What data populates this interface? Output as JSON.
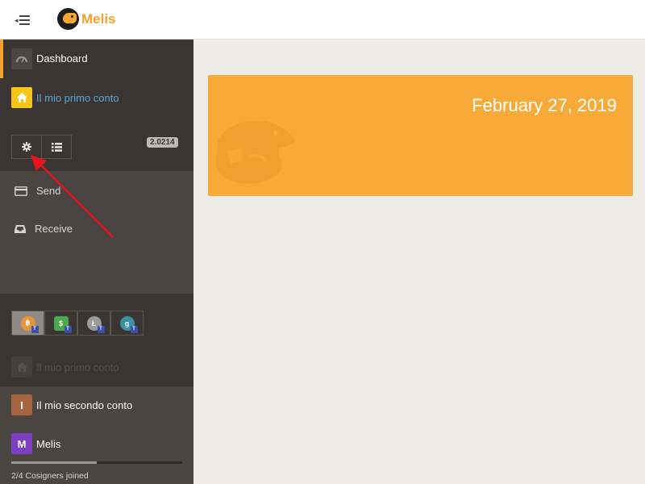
{
  "app": {
    "name": "Melis"
  },
  "sidebar": {
    "dashboard_label": "Dashboard",
    "current_account": "Il mio primo conto",
    "version_badge": "2.0214",
    "actions": [
      {
        "label": "Send",
        "icon": "credit-card-icon"
      },
      {
        "label": "Receive",
        "icon": "inbox-icon"
      }
    ],
    "currencies": [
      {
        "icon": "bitcoin-testnet-icon",
        "color": "#e8953a",
        "active": true
      },
      {
        "icon": "bitcoin-cash-testnet-icon",
        "color": "#4aa84f",
        "active": false
      },
      {
        "icon": "litecoin-testnet-icon",
        "color": "#9b9b9b",
        "active": false
      },
      {
        "icon": "groestlcoin-testnet-icon",
        "color": "#3d8fa3",
        "active": false
      }
    ],
    "faded_account": "Il mio primo conto",
    "accounts": [
      {
        "initial": "I",
        "name": "Il mio secondo conto",
        "color": "#a8633f"
      },
      {
        "initial": "M",
        "name": "Melis",
        "color": "#7c3fc4"
      }
    ],
    "cosigners_progress": 0.5,
    "cosigners_text": "2/4 Cosigners joined"
  },
  "main": {
    "banner_date": "February 27, 2019",
    "banner_color": "#f8aa38"
  },
  "colors": {
    "accent": "#f5a12c",
    "sidebar_bg": "#3a3532",
    "annotation_arrow": "#e8141c"
  }
}
